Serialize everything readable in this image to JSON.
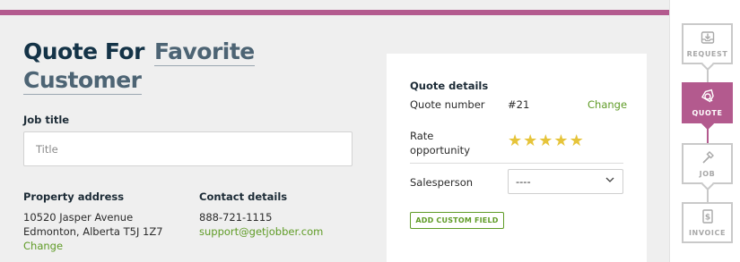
{
  "header": {
    "title_part1": "Quote For",
    "title_part2": "Favorite",
    "title_part3": "Customer",
    "accent_color": "#b35a8e"
  },
  "job_title": {
    "label": "Job title",
    "placeholder": "Title",
    "value": ""
  },
  "property_address": {
    "label": "Property address",
    "line1": "10520 Jasper Avenue",
    "line2": "Edmonton, Alberta T5J 1Z7",
    "change_link": "Change"
  },
  "contact_details": {
    "label": "Contact details",
    "phone": "888-721-1115",
    "email": "support@getjobber.com"
  },
  "quote_details": {
    "heading": "Quote details",
    "quote_number_label": "Quote number",
    "quote_number_value": "#21",
    "quote_number_change": "Change",
    "rate_label_line1": "Rate",
    "rate_label_line2": "opportunity",
    "rating": 5,
    "rating_max": 5,
    "salesperson_label": "Salesperson",
    "salesperson_value": "----",
    "add_custom_field": "ADD CUSTOM FIELD"
  },
  "workflow": {
    "steps": [
      {
        "label": "REQUEST",
        "icon": "inbox-download-icon",
        "active": false
      },
      {
        "label": "QUOTE",
        "icon": "quote-tag-icon",
        "active": true
      },
      {
        "label": "JOB",
        "icon": "hammer-icon",
        "active": false
      },
      {
        "label": "INVOICE",
        "icon": "dollar-document-icon",
        "active": false
      }
    ]
  }
}
